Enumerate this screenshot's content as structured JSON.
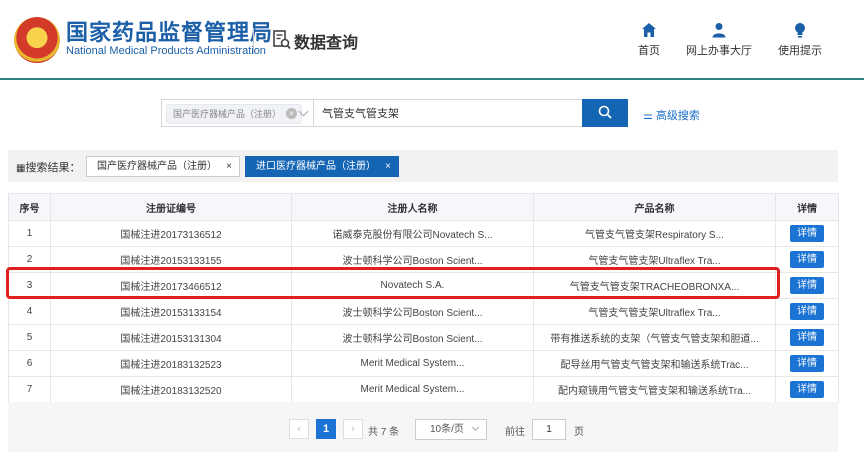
{
  "header": {
    "agency_cn": "国家药品监督管理局",
    "agency_en": "National Medical Products Administration",
    "section_title": "数据查询",
    "nav": [
      {
        "label": "首页",
        "icon": "home-icon"
      },
      {
        "label": "网上办事大厅",
        "icon": "user-icon"
      },
      {
        "label": "使用提示",
        "icon": "lightbulb-icon"
      }
    ]
  },
  "search": {
    "category_tag": "国产医疗器械产品（注册）",
    "query": "气管支气管支架",
    "advanced_label": "高级搜索"
  },
  "results": {
    "label": "搜索结果：",
    "tabs": [
      {
        "label": "国产医疗器械产品（注册）",
        "active": false
      },
      {
        "label": "进口医疗器械产品（注册）",
        "active": true
      }
    ]
  },
  "table": {
    "headers": [
      "序号",
      "注册证编号",
      "注册人名称",
      "产品名称",
      "详情"
    ],
    "rows": [
      {
        "no": "1",
        "reg_no": "国械注进20173136512",
        "registrant": "诺威泰克股份有限公司Novatech S...",
        "product": "气管支气管支架Respiratory S...",
        "detail": "详情"
      },
      {
        "no": "2",
        "reg_no": "国械注进20153133155",
        "registrant": "波士顿科学公司Boston Scient...",
        "product": "气管支气管支架Ultraflex Tra...",
        "detail": "详情"
      },
      {
        "no": "3",
        "reg_no": "国械注进20173466512",
        "registrant": "Novatech S.A.",
        "product": "气管支气管支架TRACHEOBRONXA...",
        "detail": "详情"
      },
      {
        "no": "4",
        "reg_no": "国械注进20153133154",
        "registrant": "波士顿科学公司Boston Scient...",
        "product": "气管支气管支架Ultraflex Tra...",
        "detail": "详情"
      },
      {
        "no": "5",
        "reg_no": "国械注进20153131304",
        "registrant": "波士顿科学公司Boston Scient...",
        "product": "带有推送系统的支架（气管支气管支架和胆道...",
        "detail": "详情"
      },
      {
        "no": "6",
        "reg_no": "国械注进20183132523",
        "registrant": "Merit Medical System...",
        "product": "配导丝用气管支气管支架和输送系统Trac...",
        "detail": "详情"
      },
      {
        "no": "7",
        "reg_no": "国械注进20183132520",
        "registrant": "Merit Medical System...",
        "product": "配内窥镜用气管支气管支架和输送系统Tra...",
        "detail": "详情"
      }
    ]
  },
  "pager": {
    "current": "1",
    "total_label": "共 7 条",
    "page_size": "10条/页",
    "goto_label": "前往",
    "goto_value": "1",
    "page_unit": "页",
    "prev": "‹",
    "next": "›"
  },
  "colors": {
    "brand_blue": "#1565b5",
    "highlight_red": "#e02020"
  }
}
